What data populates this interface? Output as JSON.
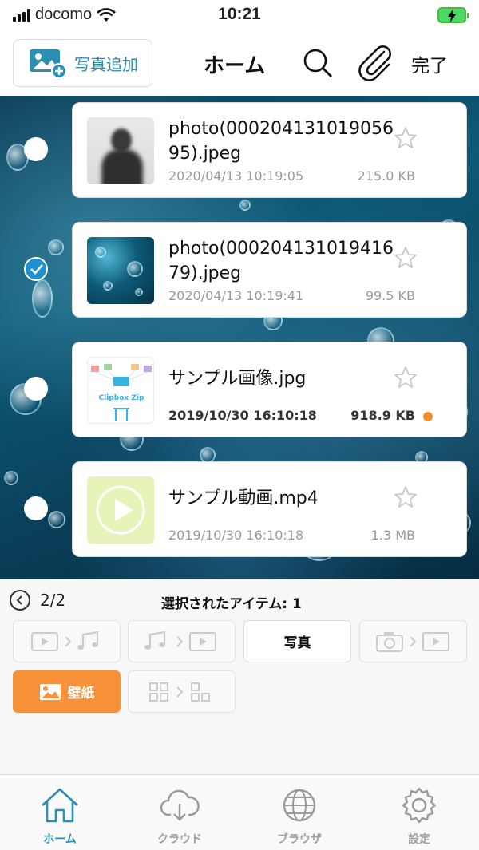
{
  "status_bar": {
    "carrier": "docomo",
    "time": "10:21"
  },
  "nav": {
    "add_photo_label": "写真追加",
    "title": "ホーム",
    "done_label": "完了"
  },
  "files": [
    {
      "name": "photo(00020413101905695).jpeg",
      "date": "2020/04/13 10:19:05",
      "size": "215.0 KB",
      "selected": false,
      "thumb": "person-photo"
    },
    {
      "name": "photo(00020413101941679).jpeg",
      "date": "2020/04/13 10:19:41",
      "size": "99.5 KB",
      "selected": true,
      "thumb": "water-photo"
    },
    {
      "name": "サンプル画像.jpg",
      "date": "2019/10/30 16:10:18",
      "size": "918.9 KB",
      "selected": false,
      "thumb": "clipbox-diagram",
      "new": true
    },
    {
      "name": "サンプル動画.mp4",
      "date": "2019/10/30 16:10:18",
      "size": "1.3 MB",
      "selected": false,
      "thumb": "video-play-icon"
    }
  ],
  "thumb_text": {
    "clipbox": "Clipbox Zip"
  },
  "panel": {
    "page": "2/2",
    "selected_label": "選択されたアイテム: 1",
    "actions": [
      {
        "icon": "video-to-music-icon",
        "enabled": false
      },
      {
        "icon": "music-to-video-icon",
        "enabled": false
      },
      {
        "label": "写真",
        "enabled": true
      },
      {
        "icon": "camera-to-video-icon",
        "enabled": false
      },
      {
        "label": "壁紙",
        "icon": "image-icon",
        "enabled": true,
        "highlight": true
      },
      {
        "icon": "grid-convert-icon",
        "enabled": false
      }
    ]
  },
  "tabs": [
    {
      "label": "ホーム",
      "icon": "home-icon",
      "active": true
    },
    {
      "label": "クラウド",
      "icon": "cloud-download-icon",
      "active": false
    },
    {
      "label": "ブラウザ",
      "icon": "globe-icon",
      "active": false
    },
    {
      "label": "設定",
      "icon": "gear-icon",
      "active": false
    }
  ],
  "colors": {
    "accent": "#2a8fb0",
    "orange": "#f7923a",
    "check": "#1e8fd1"
  }
}
